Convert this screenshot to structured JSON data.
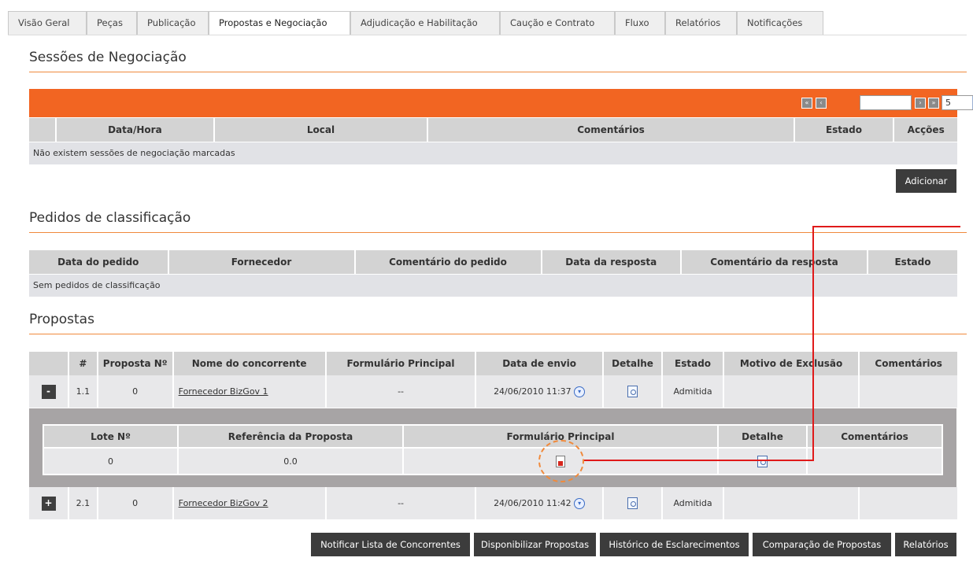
{
  "tabs": [
    "Visão Geral",
    "Peças",
    "Publicação",
    "Propostas e Negociação",
    "Adjudicação e Habilitação",
    "Caução e Contrato",
    "Fluxo",
    "Relatórios",
    "Notificações"
  ],
  "sessions": {
    "title": "Sessões de Negociação",
    "pager_size": "5",
    "headers": [
      "Data/Hora",
      "Local",
      "Comentários",
      "Estado",
      "Acções"
    ],
    "empty": "Não existem sessões de negociação marcadas",
    "add_button": "Adicionar"
  },
  "requests": {
    "title": "Pedidos de classificação",
    "headers": [
      "Data do pedido",
      "Fornecedor",
      "Comentário do pedido",
      "Data da resposta",
      "Comentário da resposta",
      "Estado"
    ],
    "empty": "Sem pedidos de classificação"
  },
  "proposals": {
    "title": "Propostas",
    "headers": [
      "#",
      "Proposta Nº",
      "Nome do concorrente",
      "Formulário Principal",
      "Data de envio",
      "Detalhe",
      "Estado",
      "Motivo de Exclusão",
      "Comentários"
    ],
    "rows": [
      {
        "toggle": "-",
        "num": "1.1",
        "proposal": "0",
        "name": "Fornecedor BizGov 1",
        "form": "--",
        "date": "24/06/2010 11:37",
        "status": "Admitida"
      },
      {
        "toggle": "+",
        "num": "2.1",
        "proposal": "0",
        "name": "Fornecedor BizGov 2",
        "form": "--",
        "date": "24/06/2010 11:42",
        "status": "Admitida"
      }
    ],
    "sub": {
      "headers": [
        "Lote Nº",
        "Referência da Proposta",
        "Formulário Principal",
        "Detalhe",
        "Comentários"
      ],
      "row": {
        "lote": "0",
        "ref": "0.0"
      }
    }
  },
  "buttons": [
    "Notificar Lista de Concorrentes",
    "Disponibilizar Propostas",
    "Histórico de Esclarecimentos",
    "Comparação de Propostas",
    "Relatórios"
  ],
  "colors": {
    "accent": "#f26522",
    "button": "#3c3c3c",
    "annotation": "#e01a1a"
  }
}
